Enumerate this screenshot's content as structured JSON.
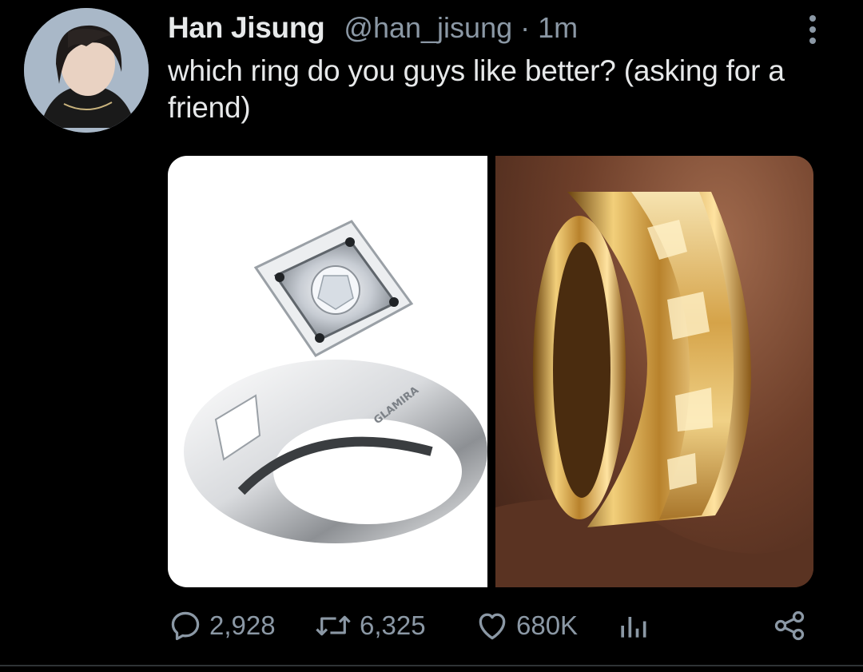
{
  "tweet": {
    "author": {
      "display_name": "Han Jisung",
      "handle": "@han_jisung",
      "separator": "·",
      "time": "1m"
    },
    "text": "which ring do you guys like better? (asking for a friend)",
    "media": [
      {
        "label": "silver ring with square-set diamond",
        "engraving": "GLAMIRA"
      },
      {
        "label": "gold ring with gold leaf inlay"
      }
    ],
    "actions": {
      "replies": "2,928",
      "retweets": "6,325",
      "likes": "680K"
    },
    "icons": {
      "reply": "reply-icon",
      "retweet": "retweet-icon",
      "like": "heart-icon",
      "analytics": "analytics-icon",
      "share": "share-icon",
      "more": "more-vertical-icon"
    }
  },
  "colors": {
    "background": "#000000",
    "text_primary": "#e7e9ea",
    "text_secondary": "#8b98a5"
  }
}
